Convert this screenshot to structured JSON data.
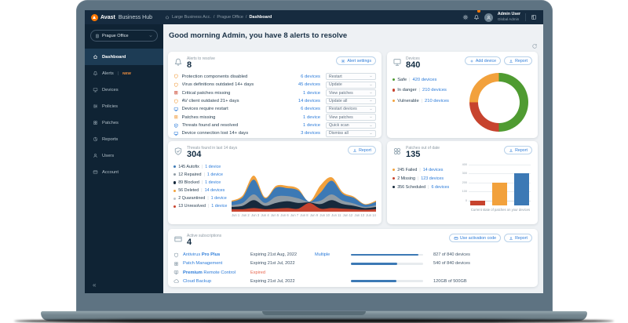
{
  "topbar": {
    "brand_bold": "Avast",
    "brand_rest": "Business Hub",
    "breadcrumb": [
      "Large Business Acc.",
      "Prague Office",
      "Dashboard"
    ],
    "user": {
      "name": "Admin User",
      "role": "Global Admin"
    }
  },
  "sidebar": {
    "org_selector": "Prague Office",
    "items": [
      {
        "label": "Dashboard",
        "icon": "home",
        "active": true
      },
      {
        "label": "Alerts",
        "icon": "bell",
        "badge": "NEW"
      },
      {
        "label": "Devices",
        "icon": "monitor"
      },
      {
        "label": "Policies",
        "icon": "sliders"
      },
      {
        "label": "Patches",
        "icon": "patches"
      },
      {
        "label": "Reports",
        "icon": "pie"
      },
      {
        "label": "Users",
        "icon": "user"
      },
      {
        "label": "Account",
        "icon": "card"
      }
    ],
    "collapse": "«"
  },
  "greeting": "Good morning Admin, you have 8 alerts to resolve",
  "alerts_card": {
    "title": "Alerts to resolve",
    "count": "8",
    "settings_button": "Alert settings",
    "rows": [
      {
        "label": "Protection components disabled",
        "devices": "6 devices",
        "action": "Restart",
        "icon": "shield",
        "color": "#f09c3d"
      },
      {
        "label": "Virus definitions outdated 14+ days",
        "devices": "45 devices",
        "action": "Update",
        "icon": "shield",
        "color": "#f09c3d"
      },
      {
        "label": "Critical patches missing",
        "devices": "1 device",
        "action": "View patches",
        "icon": "patches",
        "color": "#cc4630"
      },
      {
        "label": "AV client outdated 21+ days",
        "devices": "14 devices",
        "action": "Update all",
        "icon": "shield",
        "color": "#f09c3d"
      },
      {
        "label": "Devices require restart",
        "devices": "6 devices",
        "action": "Restart devices",
        "icon": "monitor",
        "color": "#2b7bd9"
      },
      {
        "label": "Patches missing",
        "devices": "1 device",
        "action": "View patches",
        "icon": "patches",
        "color": "#f09c3d"
      },
      {
        "label": "Threats found and resolved",
        "devices": "1 device",
        "action": "Quick scan",
        "icon": "shieldCheck",
        "color": "#2b7bd9"
      },
      {
        "label": "Device connection lost 14+ days",
        "devices": "3 devices",
        "action": "Dismiss all",
        "icon": "monitor",
        "color": "#2b7bd9"
      }
    ]
  },
  "devices_card": {
    "title": "Devices",
    "count": "840",
    "add_button": "Add device",
    "report_button": "Report",
    "legend": [
      {
        "label": "Safe",
        "value": "420 devices",
        "color": "#4f9b31"
      },
      {
        "label": "In danger",
        "value": "210 devices",
        "color": "#c7432e"
      },
      {
        "label": "Vulnerable",
        "value": "210 devices",
        "color": "#f2a13c"
      }
    ]
  },
  "threats_card": {
    "title": "Threats found in last 14 days",
    "count": "304",
    "report_button": "Report",
    "legend": [
      {
        "text": "145 Autofix",
        "value": "1 device",
        "color": "#3c79b5"
      },
      {
        "text": "12 Repaired",
        "value": "1 device",
        "color": "#8f9ba4"
      },
      {
        "text": "89 Blocked",
        "value": "1 device",
        "color": "#16293c"
      },
      {
        "text": "56 Deleted",
        "value": "14 devices",
        "color": "#f2a13c"
      },
      {
        "text": "2 Quarantined",
        "value": "1 device",
        "color": "#b9c2c9"
      },
      {
        "text": "13 Unresolved",
        "value": "1 device",
        "color": "#c7432e"
      }
    ]
  },
  "patches_card": {
    "title": "Patches out of date",
    "count": "135",
    "report_button": "Report",
    "legend": [
      {
        "text": "245 Failed",
        "value": "14 devices",
        "color": "#f2a13c"
      },
      {
        "text": "2 Missing",
        "value": "123 devices",
        "color": "#c7432e"
      },
      {
        "text": "356 Scheduled",
        "value": "6 devices",
        "color": "#16293c"
      }
    ]
  },
  "subscriptions_card": {
    "title": "Active subscriptions",
    "count": "4",
    "activation_button": "Use activation code",
    "report_button": "Report",
    "rows": [
      {
        "icon": "shield",
        "name_pre": "Antivirus ",
        "name_bold": "Pro Plus",
        "name_suf": "",
        "expiry": "Expiring 21st Aug, 2022",
        "expiry_color": "#3f5468",
        "extra": "Multiple",
        "progress": 0.93,
        "usage": "827 of 840 devices"
      },
      {
        "icon": "patches",
        "name_pre": "Patch Management",
        "name_bold": "",
        "name_suf": "",
        "expiry": "Expiring 21st Jul, 2022",
        "expiry_color": "#3f5468",
        "extra": "",
        "progress": 0.64,
        "usage": "540 of 840 devices"
      },
      {
        "icon": "remote",
        "name_pre": "",
        "name_bold": "Premium",
        "name_suf": " Remote Control",
        "expiry": "Expired",
        "expiry_color": "#e8654d",
        "extra": "",
        "progress": null,
        "usage": ""
      },
      {
        "icon": "cloud",
        "name_pre": "Cloud Backup",
        "name_bold": "",
        "name_suf": "",
        "expiry": "Expiring 21st Jul, 2022",
        "expiry_color": "#3f5468",
        "extra": "",
        "progress": 0.63,
        "usage": "120GB of 500GB"
      }
    ]
  },
  "chart_data": [
    {
      "type": "pie",
      "title": "Devices",
      "labels": [
        "Safe",
        "In danger",
        "Vulnerable"
      ],
      "values": [
        420,
        210,
        210
      ],
      "colors": [
        "#4f9b31",
        "#c7432e",
        "#f2a13c"
      ],
      "donut": true,
      "legend_position": "left"
    },
    {
      "type": "area",
      "title": "Threats found in last 14 days",
      "stacked": true,
      "x": [
        "Jun 1",
        "Jun 2",
        "Jun 3",
        "Jun 4",
        "Jun 5",
        "Jun 6",
        "Jun 7",
        "Jun 8",
        "Jun 9",
        "Jun 10",
        "Jun 11",
        "Jun 12",
        "Jun 13",
        "Jun 14"
      ],
      "series": [
        {
          "name": "Unresolved",
          "color": "#c7432e",
          "values": [
            1.5,
            1.5,
            2.5,
            1.5,
            2,
            2.5,
            2,
            7,
            2,
            2.5,
            2,
            1.5,
            1,
            1.5
          ]
        },
        {
          "name": "Blocked",
          "color": "#16293c",
          "values": [
            2,
            3,
            7,
            3,
            5,
            6,
            5,
            0.5,
            4,
            7,
            4,
            3,
            1.5,
            2
          ]
        },
        {
          "name": "Repaired",
          "color": "#8f9ba4",
          "values": [
            1.5,
            2.5,
            5,
            2.5,
            5.5,
            4.5,
            4,
            0.3,
            3,
            5,
            3,
            2,
            1,
            1.5
          ]
        },
        {
          "name": "Autofix",
          "color": "#3c79b5",
          "values": [
            3,
            5,
            13,
            4,
            8,
            7,
            7,
            0.3,
            7,
            12,
            6,
            5,
            2,
            3
          ]
        },
        {
          "name": "Deleted",
          "color": "#f2a13c",
          "values": [
            1,
            1.5,
            3.5,
            1,
            1.5,
            2,
            1.5,
            0.2,
            6.5,
            3,
            1.5,
            1,
            0.5,
            1
          ]
        }
      ],
      "grid": false,
      "legend_position": "left"
    },
    {
      "type": "bar",
      "title": "Patches out of date",
      "categories": [
        "Missing",
        "Failed",
        "Scheduled"
      ],
      "values": [
        2,
        245,
        356
      ],
      "colors": [
        "#c7432e",
        "#f2a13c",
        "#3c79b5"
      ],
      "ylim": [
        0,
        400
      ],
      "yticks": [
        400,
        300,
        200,
        100,
        0
      ],
      "xlabel": "Current state of patches on your devices",
      "grid": true
    }
  ]
}
